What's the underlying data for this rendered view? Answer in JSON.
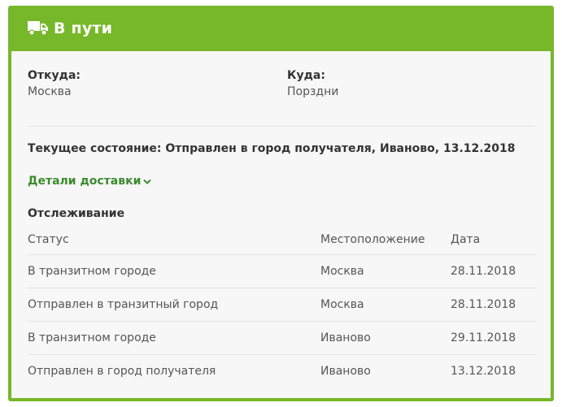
{
  "header": {
    "icon": "truck-icon",
    "title": "В пути"
  },
  "route": {
    "from_label": "Откуда:",
    "from_value": "Москва",
    "to_label": "Куда:",
    "to_value": "Порздни"
  },
  "current_state": "Текущее состояние: Отправлен в город получателя, Иваново, 13.12.2018",
  "details_link": {
    "label": "Детали доставки",
    "icon": "chevron-down-icon"
  },
  "tracking": {
    "title": "Отслеживание",
    "columns": [
      "Статус",
      "Местоположение",
      "Дата"
    ],
    "rows": [
      {
        "status": "В транзитном городе",
        "location": "Москва",
        "date": "28.11.2018"
      },
      {
        "status": "Отправлен в транзитный город",
        "location": "Москва",
        "date": "28.11.2018"
      },
      {
        "status": "В транзитном городе",
        "location": "Иваново",
        "date": "29.11.2018"
      },
      {
        "status": "Отправлен в город получателя",
        "location": "Иваново",
        "date": "13.12.2018"
      }
    ]
  },
  "colors": {
    "accent_green": "#76b82a",
    "link_green": "#3b8b2e",
    "body_bg": "#f7f7f7"
  }
}
